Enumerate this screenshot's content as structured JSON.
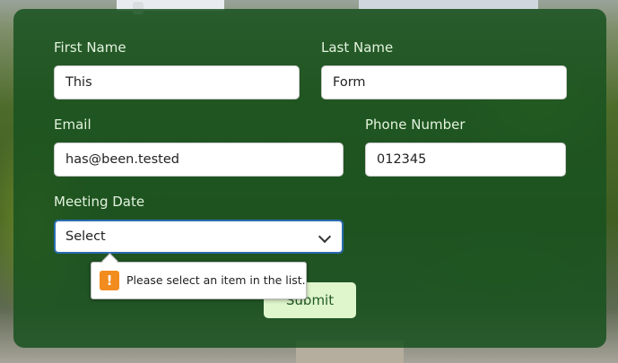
{
  "form": {
    "first_name": {
      "label": "First Name",
      "value": "This"
    },
    "last_name": {
      "label": "Last Name",
      "value": "Form"
    },
    "email": {
      "label": "Email",
      "value": "has@been.tested"
    },
    "phone": {
      "label": "Phone Number",
      "value": "012345"
    },
    "meeting_date": {
      "label": "Meeting Date",
      "selected": "Select"
    },
    "submit_label": "Submit"
  },
  "validation": {
    "message": "Please select an item in the list.",
    "icon": "warning-icon",
    "icon_glyph": "!"
  },
  "colors": {
    "panel": "#185220",
    "label_text": "#e3f3de",
    "submit_bg": "#dff5cc",
    "submit_text": "#215a24",
    "focus_border": "#2b6cb0",
    "warning": "#f28c1e"
  }
}
